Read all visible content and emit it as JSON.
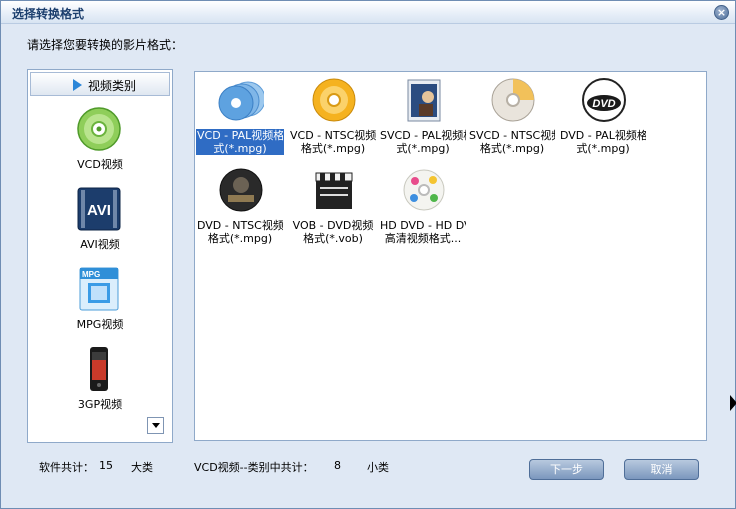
{
  "window": {
    "title": "选择转换格式",
    "prompt": "请选择您要转换的影片格式：",
    "close_symbol": "×"
  },
  "sidebar": {
    "header_label": "视频类别",
    "items": [
      {
        "label": "VCD视频",
        "icon": "vcd-disc-icon"
      },
      {
        "label": "AVI视频",
        "icon": "avi-film-icon"
      },
      {
        "label": "MPG视频",
        "icon": "mpg-film-icon"
      },
      {
        "label": "3GP视频",
        "icon": "phone-icon"
      }
    ]
  },
  "formats": {
    "selected_index": 0,
    "items": [
      {
        "lines": [
          "VCD - PAL视频格",
          "式(*.mpg)"
        ],
        "icon": "vcd-pal-discs-icon"
      },
      {
        "lines": [
          "VCD - NTSC视频",
          "格式(*.mpg)"
        ],
        "icon": "vcd-ntsc-disc-icon"
      },
      {
        "lines": [
          "SVCD - PAL视频格",
          "式(*.mpg)"
        ],
        "icon": "svcd-pal-case-icon"
      },
      {
        "lines": [
          "SVCD - NTSC视频",
          "格式(*.mpg)"
        ],
        "icon": "svcd-ntsc-disc-icon"
      },
      {
        "lines": [
          "DVD - PAL视频格",
          "式(*.mpg)"
        ],
        "icon": "dvd-pal-disc-icon"
      },
      {
        "lines": [
          "DVD - NTSC视频",
          "格式(*.mpg)"
        ],
        "icon": "dvd-ntsc-witcher-icon"
      },
      {
        "lines": [
          "VOB  - DVD视频",
          "格式(*.vob)"
        ],
        "icon": "vob-clapperboard-icon"
      },
      {
        "lines": [
          "HD DVD - HD DVD",
          "高清视频格式..."
        ],
        "icon": "hd-dvd-disc-icon"
      }
    ]
  },
  "footer": {
    "software_total_label": "软件共计：",
    "software_total_count": "15",
    "software_total_unit": "大类",
    "category_label": "VCD视频--类别中共计：",
    "category_count": "8",
    "category_unit": "小类",
    "next_button": "下一步",
    "cancel_button": "取消"
  },
  "colors": {
    "accent": "#2f6cc4",
    "window_bg": "#dfe8f4",
    "button": "#7b97bd"
  }
}
